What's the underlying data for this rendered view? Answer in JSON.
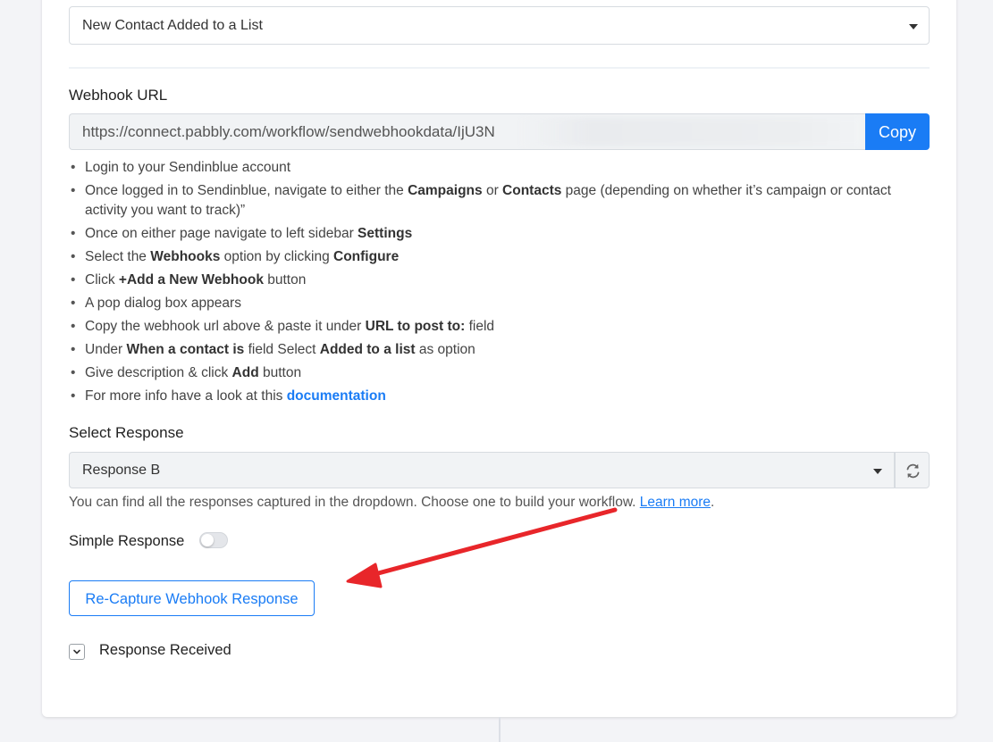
{
  "trigger_select": {
    "value": "New Contact Added to a List"
  },
  "webhook": {
    "label": "Webhook URL",
    "url": "https://connect.pabbly.com/workflow/sendwebhookdata/IjU3N",
    "copy_label": "Copy"
  },
  "steps": [
    [
      {
        "t": "Login to your Sendinblue account"
      }
    ],
    [
      {
        "t": "Once logged in to Sendinblue, navigate to either the "
      },
      {
        "t": "Campaigns",
        "b": true
      },
      {
        "t": " or "
      },
      {
        "t": "Contacts",
        "b": true
      },
      {
        "t": " page (depending on whether it’s campaign or contact activity you want to track)”"
      }
    ],
    [
      {
        "t": "Once on either page navigate to left sidebar "
      },
      {
        "t": "Settings",
        "b": true
      }
    ],
    [
      {
        "t": "Select the "
      },
      {
        "t": "Webhooks",
        "b": true
      },
      {
        "t": " option by clicking "
      },
      {
        "t": "Configure",
        "b": true
      }
    ],
    [
      {
        "t": "Click "
      },
      {
        "t": "+Add a New Webhook",
        "b": true
      },
      {
        "t": " button"
      }
    ],
    [
      {
        "t": "A pop dialog box appears"
      }
    ],
    [
      {
        "t": "Copy the webhook url above & paste it under "
      },
      {
        "t": "URL to post to:",
        "b": true
      },
      {
        "t": " field"
      }
    ],
    [
      {
        "t": "Under "
      },
      {
        "t": "When a contact is",
        "b": true
      },
      {
        "t": " field Select "
      },
      {
        "t": "Added to a list",
        "b": true
      },
      {
        "t": " as option"
      }
    ],
    [
      {
        "t": "Give description & click "
      },
      {
        "t": "Add",
        "b": true
      },
      {
        "t": " button"
      }
    ],
    [
      {
        "t": "For more info have a look at this "
      },
      {
        "t": "documentation",
        "link": true
      }
    ]
  ],
  "response": {
    "label": "Select Response",
    "value": "Response B",
    "help_text": "You can find all the responses captured in the dropdown. Choose one to build your workflow. ",
    "learn_more": "Learn more",
    "help_suffix": "."
  },
  "simple_response": {
    "label": "Simple Response",
    "enabled": false
  },
  "recapture_label": "Re-Capture Webhook Response",
  "response_received_label": "Response Received",
  "colors": {
    "accent": "#1a7cf5",
    "arrow": "#e8262a"
  }
}
